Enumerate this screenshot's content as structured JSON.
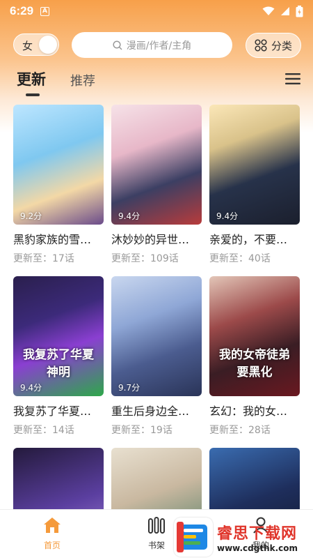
{
  "status_bar": {
    "time": "6:29",
    "indicator": "A"
  },
  "header": {
    "gender_label": "女",
    "search_placeholder": "漫画/作者/主角",
    "category_label": "分类"
  },
  "tabs": [
    {
      "label": "更新",
      "active": true
    },
    {
      "label": "推荐",
      "active": false
    }
  ],
  "cards": [
    {
      "title": "黑豹家族的雪…",
      "update": "更新至：17话",
      "score": "9.2分"
    },
    {
      "title": "沐妙妙的异世…",
      "update": "更新至：109话",
      "score": "9.4分"
    },
    {
      "title": "亲爱的，不要…",
      "update": "更新至：40话",
      "score": "9.4分"
    },
    {
      "title": "我复苏了华夏…",
      "update": "更新至：14话",
      "score": "9.4分",
      "art_text": "我复苏了华夏神明"
    },
    {
      "title": "重生后身边全…",
      "update": "更新至：19话",
      "score": "9.7分"
    },
    {
      "title": "玄幻：我的女…",
      "update": "更新至：28话",
      "score": "",
      "art_text": "我的女帝徒弟要黑化"
    },
    {
      "title": "",
      "update": "",
      "score": ""
    },
    {
      "title": "",
      "update": "",
      "score": ""
    },
    {
      "title": "",
      "update": "",
      "score": ""
    }
  ],
  "bottom_nav": [
    {
      "label": "首页",
      "active": true
    },
    {
      "label": "书架",
      "active": false
    },
    {
      "label": "我的",
      "active": false
    }
  ],
  "watermark": {
    "title": "睿思下载网",
    "url": "www.cdgthk.com"
  },
  "colors": {
    "accent": "#f59a3b",
    "header_orange": "#f7a04a"
  }
}
